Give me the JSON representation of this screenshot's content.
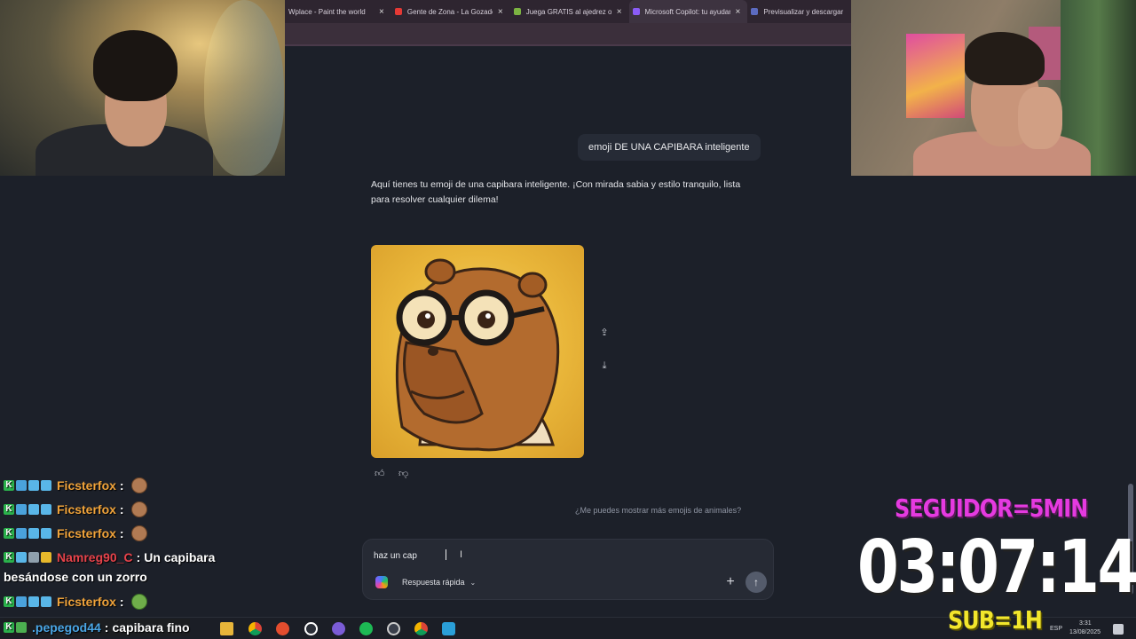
{
  "browser": {
    "tabs": [
      {
        "label": "Wplace - Paint the world",
        "favicon_color": "#3b6fd8",
        "active": false
      },
      {
        "label": "Gente de Zona - La Gozadera",
        "favicon_color": "#e53935",
        "active": false
      },
      {
        "label": "Juega GRATIS al ajedrez online",
        "favicon_color": "#7cb342",
        "active": false
      },
      {
        "label": "Microsoft Copilot: tu ayudante",
        "favicon_color": "#8b5cf6",
        "active": true
      },
      {
        "label": "Previsualizar y descargar",
        "favicon_color": "#5c6bc0",
        "active": false
      }
    ],
    "tab_close_glyph": "×"
  },
  "chat": {
    "user_message": "emoji DE UNA CAPIBARA inteligente",
    "ai_response": "Aquí tienes tu emoji de una capibara inteligente. ¡Con mirada sabia y estilo tranquilo, lista para resolver cualquier dilema!",
    "suggestion": "¿Me puedes mostrar más emojis de animales?"
  },
  "composer": {
    "input_value": "haz un cap",
    "mode_label": "Respuesta rápida"
  },
  "icons": {
    "share": "share-icon",
    "download": "download-icon",
    "thumbs_up": "thumbs-up-icon",
    "thumbs_down": "thumbs-down-icon",
    "add": "plus-icon",
    "send": "arrow-up-icon"
  },
  "stream_chat": [
    {
      "user": "Ficsterfox",
      "color": "#f0a33a",
      "text": "",
      "emote": "capybara"
    },
    {
      "user": "Ficsterfox",
      "color": "#f0a33a",
      "text": "",
      "emote": "capybara"
    },
    {
      "user": "Ficsterfox",
      "color": "#f0a33a",
      "text": "",
      "emote": "capybara"
    },
    {
      "user": "Namreg90_C",
      "color": "#e8434b",
      "text": "Un capibara",
      "continuation": "besándose con un zorro"
    },
    {
      "user": "Ficsterfox",
      "color": "#f0a33a",
      "text": "",
      "emote": "pepe"
    },
    {
      "user": ".pepegod44",
      "color": "#4aa6e6",
      "text": "capibara fino"
    }
  ],
  "overlay": {
    "follower_rule": "SEGUIDOR=5MIN",
    "timer": "03:07:14",
    "sub_rule": "SUB=1H",
    "colors": {
      "follower": "#e53ae0",
      "timer": "#ffffff",
      "sub": "#f2e62c"
    }
  },
  "taskbar": {
    "language": "ESP",
    "time": "3:31",
    "date": "13/08/2025"
  }
}
